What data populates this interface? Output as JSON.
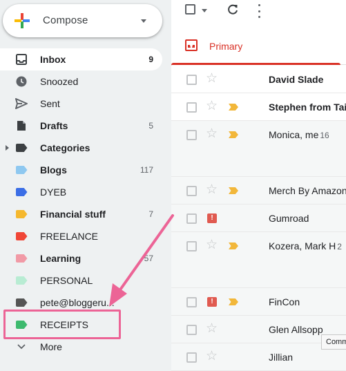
{
  "compose": {
    "label": "Compose"
  },
  "nav": {
    "items": [
      {
        "label": "Inbox",
        "count": "9",
        "icon": "inbox-icon"
      },
      {
        "label": "Snoozed",
        "count": "",
        "icon": "clock-icon"
      },
      {
        "label": "Sent",
        "count": "",
        "icon": "send-icon"
      },
      {
        "label": "Drafts",
        "count": "5",
        "icon": "draft-icon"
      },
      {
        "label": "Categories",
        "count": "",
        "icon": "label-icon"
      },
      {
        "label": "Blogs",
        "count": "117",
        "icon": "label-icon",
        "color": "#8ec8f0"
      },
      {
        "label": "DYEB",
        "count": "",
        "icon": "label-icon",
        "color": "#3b6ee6"
      },
      {
        "label": "Financial stuff",
        "count": "7",
        "icon": "label-icon",
        "color": "#f5b82e"
      },
      {
        "label": "FREELANCE",
        "count": "",
        "icon": "label-icon",
        "color": "#f04637"
      },
      {
        "label": "Learning",
        "count": "57",
        "icon": "label-icon",
        "color": "#f19aa6"
      },
      {
        "label": "PERSONAL",
        "count": "",
        "icon": "label-icon",
        "color": "#b8ecd3"
      },
      {
        "label": "pete@bloggeru...",
        "count": "",
        "icon": "label-icon",
        "color": "#555555"
      },
      {
        "label": "RECEIPTS",
        "count": "",
        "icon": "label-icon",
        "color": "#3dba6e"
      },
      {
        "label": "More",
        "count": "",
        "icon": "chevron-down-icon"
      }
    ]
  },
  "tabs": {
    "primary": "Primary"
  },
  "emails": [
    {
      "sender": "David Slade",
      "count": ""
    },
    {
      "sender": "Stephen from Tai",
      "count": ""
    },
    {
      "sender": "Monica, me",
      "count": "16"
    },
    {
      "sender": "Merch By Amazon",
      "count": ""
    },
    {
      "sender": "Gumroad",
      "count": ""
    },
    {
      "sender": "Kozera, Mark H",
      "count": "2"
    },
    {
      "sender": "FinCon",
      "count": ""
    },
    {
      "sender": "Glen Allsopp",
      "count": ""
    },
    {
      "sender": "Jillian",
      "count": ""
    }
  ],
  "tooltip": {
    "text": "Comm"
  },
  "colors": {
    "accent": "#d93025",
    "annotation": "#ec6496",
    "important": "#f2b73a"
  }
}
